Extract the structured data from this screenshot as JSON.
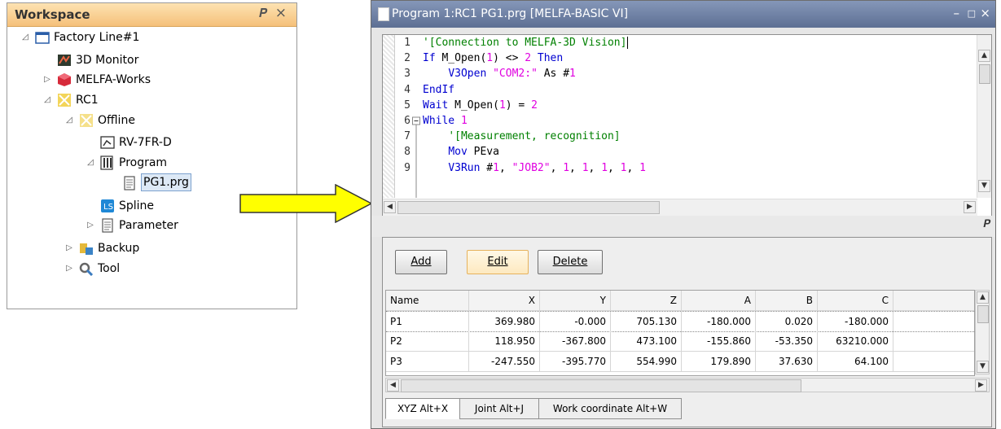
{
  "workspace": {
    "title": "Workspace",
    "tree": [
      {
        "label": "Factory Line#1",
        "icon": "factory-line-icon",
        "expander": "◿"
      },
      {
        "label": "3D Monitor",
        "icon": "3d-monitor-icon",
        "expander": ""
      },
      {
        "label": "MELFA-Works",
        "icon": "melfa-works-icon",
        "expander": "▷"
      },
      {
        "label": "RC1",
        "icon": "robot-controller-icon",
        "expander": "◿"
      },
      {
        "label": "Offline",
        "icon": "offline-icon",
        "expander": "◿"
      },
      {
        "label": "RV-7FR-D",
        "icon": "robot-model-icon",
        "expander": ""
      },
      {
        "label": "Program",
        "icon": "program-folder-icon",
        "expander": "◿"
      },
      {
        "label": "PG1.prg",
        "icon": "program-file-icon",
        "expander": ""
      },
      {
        "label": "Spline",
        "icon": "spline-icon",
        "expander": ""
      },
      {
        "label": "Parameter",
        "icon": "parameter-icon",
        "expander": "▷"
      },
      {
        "label": "Backup",
        "icon": "backup-icon",
        "expander": "▷"
      },
      {
        "label": "Tool",
        "icon": "tool-icon",
        "expander": "▷"
      }
    ]
  },
  "program_window": {
    "title": "Program 1:RC1 PG1.prg  [MELFA-BASIC VI]",
    "line_numbers": [
      "1",
      "2",
      "3",
      "4",
      "5",
      "6",
      "7",
      "8",
      "9"
    ],
    "code": [
      [
        [
          "c-cmt",
          "'[Connection to MELFA-3D Vision]"
        ]
      ],
      [
        [
          "c-kw",
          "If "
        ],
        [
          "c-txt",
          "M_Open("
        ],
        [
          "c-num",
          "1"
        ],
        [
          "c-txt",
          ") <> "
        ],
        [
          "c-num",
          "2"
        ],
        [
          "c-kw",
          " Then"
        ]
      ],
      [
        [
          "c-txt",
          "    "
        ],
        [
          "c-kw",
          "V3Open "
        ],
        [
          "c-str",
          "\"COM2:\""
        ],
        [
          "c-txt",
          " As #"
        ],
        [
          "c-num",
          "1"
        ]
      ],
      [
        [
          "c-kw",
          "EndIf"
        ]
      ],
      [
        [
          "c-kw",
          "Wait "
        ],
        [
          "c-txt",
          "M_Open("
        ],
        [
          "c-num",
          "1"
        ],
        [
          "c-txt",
          ") = "
        ],
        [
          "c-num",
          "2"
        ]
      ],
      [
        [
          "c-kw",
          "While "
        ],
        [
          "c-num",
          "1"
        ]
      ],
      [
        [
          "c-txt",
          "    "
        ],
        [
          "c-cmt",
          "'[Measurement, recognition]"
        ]
      ],
      [
        [
          "c-txt",
          "    "
        ],
        [
          "c-kw",
          "Mov "
        ],
        [
          "c-txt",
          "PEva"
        ]
      ],
      [
        [
          "c-txt",
          "    "
        ],
        [
          "c-kw",
          "V3Run "
        ],
        [
          "c-txt",
          "#"
        ],
        [
          "c-num",
          "1"
        ],
        [
          "c-txt",
          ", "
        ],
        [
          "c-str",
          "\"JOB2\""
        ],
        [
          "c-txt",
          ", "
        ],
        [
          "c-num",
          "1"
        ],
        [
          "c-txt",
          ", "
        ],
        [
          "c-num",
          "1"
        ],
        [
          "c-txt",
          ", "
        ],
        [
          "c-num",
          "1"
        ],
        [
          "c-txt",
          ", "
        ],
        [
          "c-num",
          "1"
        ],
        [
          "c-txt",
          ", "
        ],
        [
          "c-num",
          "1"
        ]
      ]
    ],
    "buttons": {
      "add": "Add",
      "edit": "Edit",
      "delete": "Delete"
    },
    "table": {
      "headers": [
        "Name",
        "X",
        "Y",
        "Z",
        "A",
        "B",
        "C"
      ],
      "rows": [
        [
          "P1",
          "369.980",
          "-0.000",
          "705.130",
          "-180.000",
          "0.020",
          "-180.000"
        ],
        [
          "P2",
          "118.950",
          "-367.800",
          "473.100",
          "-155.860",
          "-53.350",
          "63210.000"
        ],
        [
          "P3",
          "-247.550",
          "-395.770",
          "554.990",
          "179.890",
          "37.630",
          "64.100"
        ]
      ]
    },
    "tabs": [
      "XYZ  Alt+X",
      "Joint  Alt+J",
      "Work coordinate  Alt+W"
    ]
  }
}
